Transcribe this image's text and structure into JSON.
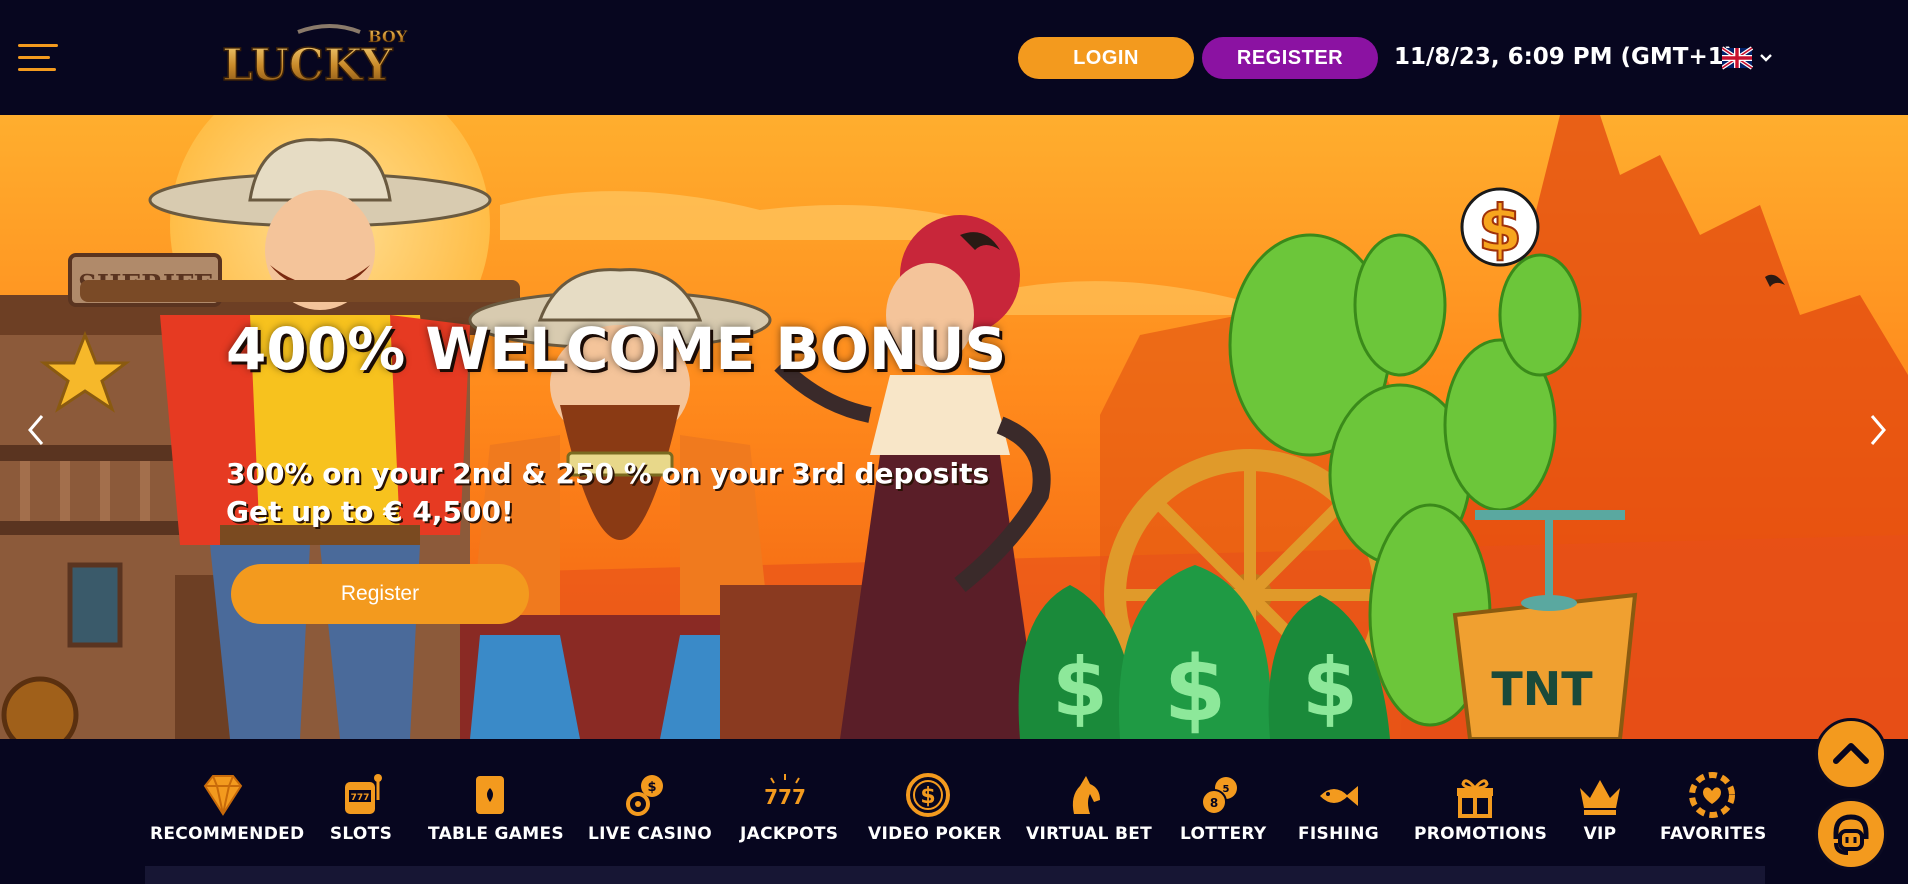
{
  "header": {
    "menu_icon": "hamburger-menu-icon",
    "logo_text": "LUCKY",
    "logo_badge": "BOY",
    "login_label": "LOGIN",
    "register_label": "REGISTER",
    "datetime": "11/8/23, 6:09 PM (GMT+1)",
    "language_icon": "uk-flag-icon"
  },
  "banner": {
    "title": "400% WELCOME BONUS",
    "subtitle_line1": "300% on your 2nd & 250 % on your 3rd deposits",
    "subtitle_line2": "Get up to € 4,500!",
    "cta_label": "Register",
    "sign_text": "SHERIFF",
    "crate_text": "TNT",
    "prev_icon": "chevron-left-icon",
    "next_icon": "chevron-right-icon"
  },
  "categories": [
    {
      "label": "RECOMMENDED",
      "icon": "diamond-icon"
    },
    {
      "label": "SLOTS",
      "icon": "slot-machine-icon"
    },
    {
      "label": "TABLE GAMES",
      "icon": "playing-cards-icon"
    },
    {
      "label": "LIVE CASINO",
      "icon": "live-casino-icon"
    },
    {
      "label": "JACKPOTS",
      "icon": "jackpot-777-icon"
    },
    {
      "label": "VIDEO POKER",
      "icon": "dollar-coin-icon"
    },
    {
      "label": "VIRTUAL BET",
      "icon": "horse-icon"
    },
    {
      "label": "LOTTERY",
      "icon": "lottery-balls-icon"
    },
    {
      "label": "FISHING",
      "icon": "fish-icon"
    },
    {
      "label": "PROMOTIONS",
      "icon": "gift-icon"
    },
    {
      "label": "VIP",
      "icon": "crown-icon"
    },
    {
      "label": "FAVORITES",
      "icon": "favorite-chip-icon"
    }
  ],
  "floating": {
    "scroll_top_icon": "chevron-up-icon",
    "support_icon": "headset-support-icon"
  },
  "colors": {
    "background": "#07061f",
    "accent_orange": "#f39a1e",
    "accent_purple": "#8b12a2"
  }
}
